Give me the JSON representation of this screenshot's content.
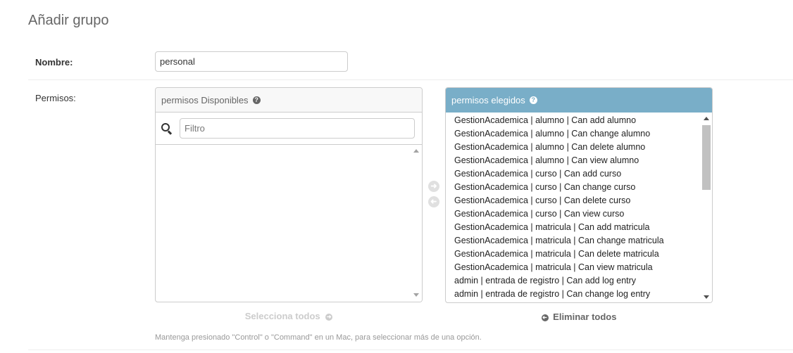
{
  "page": {
    "title": "Añadir grupo"
  },
  "name_field": {
    "label": "Nombre:",
    "value": "personal"
  },
  "permissions_field": {
    "label": "Permisos:",
    "available": {
      "title": "permisos Disponibles",
      "help_icon": "?",
      "filter_placeholder": "Filtro",
      "items": []
    },
    "chosen": {
      "title": "permisos elegidos",
      "help_icon": "?",
      "items": [
        "GestionAcademica | alumno | Can add alumno",
        "GestionAcademica | alumno | Can change alumno",
        "GestionAcademica | alumno | Can delete alumno",
        "GestionAcademica | alumno | Can view alumno",
        "GestionAcademica | curso | Can add curso",
        "GestionAcademica | curso | Can change curso",
        "GestionAcademica | curso | Can delete curso",
        "GestionAcademica | curso | Can view curso",
        "GestionAcademica | matricula | Can add matricula",
        "GestionAcademica | matricula | Can change matricula",
        "GestionAcademica | matricula | Can delete matricula",
        "GestionAcademica | matricula | Can view matricula",
        "admin | entrada de registro | Can add log entry",
        "admin | entrada de registro | Can change log entry"
      ]
    },
    "choose_all_label": "Selecciona todos",
    "remove_all_label": "Eliminar todos",
    "help_text": "Mantenga presionado \"Control\" o \"Command\" en un Mac, para seleccionar más de una opción."
  },
  "icons": {
    "add": "arrow-right-circle-icon",
    "remove": "arrow-left-circle-icon",
    "search": "search-icon",
    "help": "help-icon"
  },
  "colors": {
    "chosen_header": "#79aec8",
    "disabled": "#cccccc"
  }
}
